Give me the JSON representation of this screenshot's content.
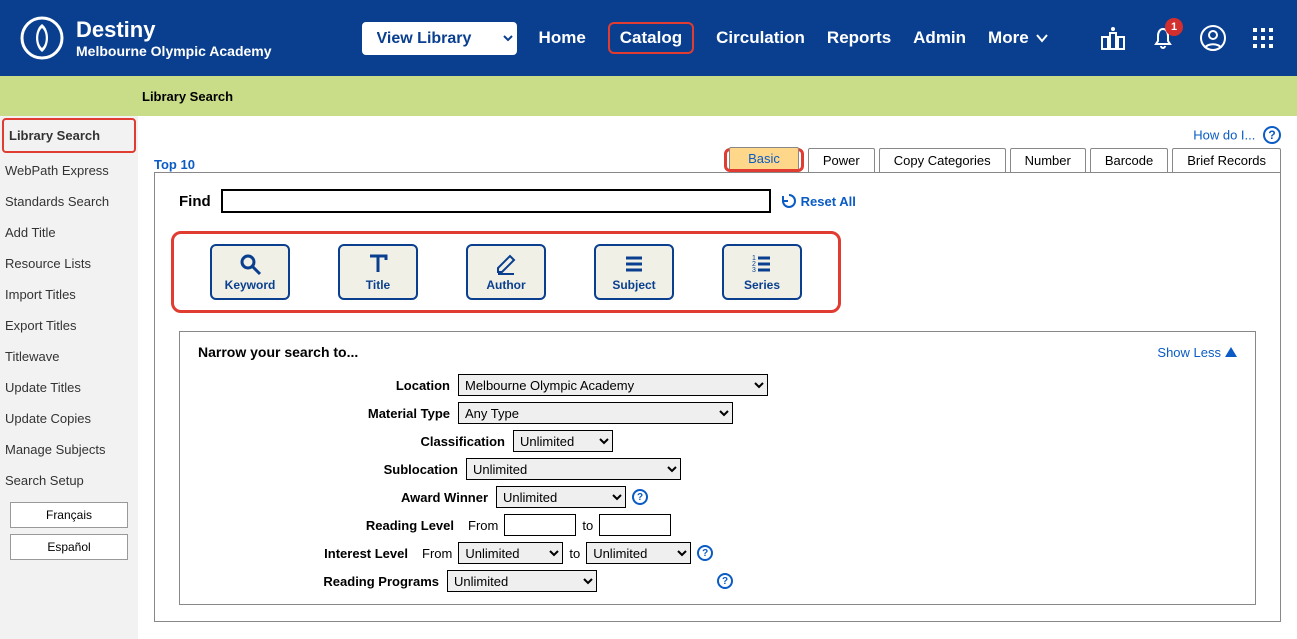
{
  "header": {
    "brand_title": "Destiny",
    "brand_sub": "Melbourne Olympic Academy",
    "view_select": "View Library",
    "nav": [
      "Home",
      "Catalog",
      "Circulation",
      "Reports",
      "Admin",
      "More"
    ],
    "notif_count": "1"
  },
  "subheader": {
    "title": "Library Search"
  },
  "sidebar": {
    "items": [
      "Library Search",
      "WebPath Express",
      "Standards Search",
      "Add Title",
      "Resource Lists",
      "Import Titles",
      "Export Titles",
      "Titlewave",
      "Update Titles",
      "Update Copies",
      "Manage Subjects",
      "Search Setup"
    ],
    "lang1": "Français",
    "lang2": "Español"
  },
  "main": {
    "help": "How do I...",
    "top10": "Top 10",
    "tabs": [
      "Basic",
      "Power",
      "Copy Categories",
      "Number",
      "Barcode",
      "Brief Records"
    ],
    "find_label": "Find",
    "reset": "Reset All",
    "search_buttons": [
      "Keyword",
      "Title",
      "Author",
      "Subject",
      "Series"
    ],
    "narrow": {
      "title": "Narrow your search to...",
      "showless": "Show Less",
      "location_label": "Location",
      "location_value": "Melbourne Olympic Academy",
      "material_label": "Material Type",
      "material_value": "Any Type",
      "class_label": "Classification",
      "class_value": "Unlimited",
      "subloc_label": "Sublocation",
      "subloc_value": "Unlimited",
      "award_label": "Award Winner",
      "award_value": "Unlimited",
      "reading_label": "Reading Level",
      "from": "From",
      "to": "to",
      "interest_label": "Interest Level",
      "interest_from_value": "Unlimited",
      "interest_to_value": "Unlimited",
      "programs_label": "Reading Programs",
      "programs_value": "Unlimited"
    }
  }
}
